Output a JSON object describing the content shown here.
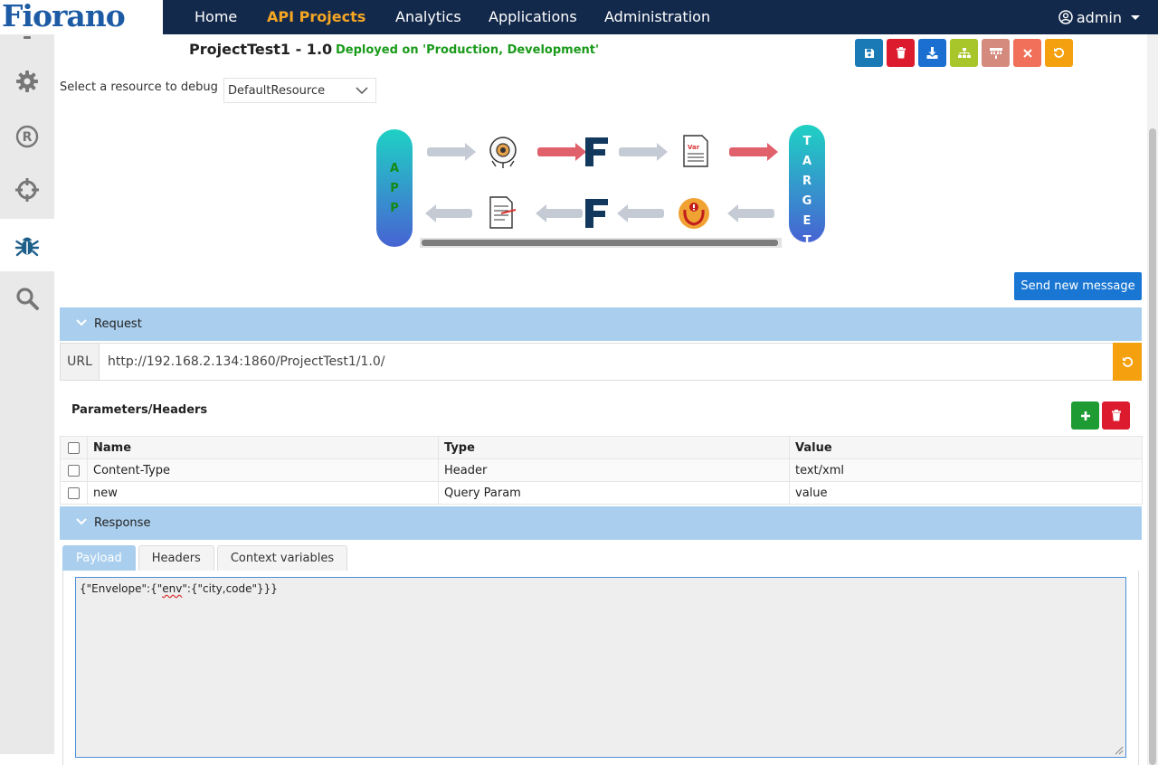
{
  "brand": {
    "logo_text": "Fiorano"
  },
  "nav": {
    "items": [
      {
        "label": "Home",
        "active": false
      },
      {
        "label": "API Projects",
        "active": true
      },
      {
        "label": "Analytics",
        "active": false
      },
      {
        "label": "Applications",
        "active": false
      },
      {
        "label": "Administration",
        "active": false
      }
    ],
    "user": "admin"
  },
  "sidebar": {
    "items": [
      {
        "icon": "gear-icon",
        "active": false
      },
      {
        "icon": "registered-icon",
        "active": false
      },
      {
        "icon": "crosshair-icon",
        "active": false
      },
      {
        "icon": "bug-icon",
        "active": true
      },
      {
        "icon": "search-icon",
        "active": false
      }
    ]
  },
  "project": {
    "title": "ProjectTest1 - 1.0",
    "deployed": "Deployed on 'Production, Development'"
  },
  "toolbar": {
    "buttons": [
      {
        "icon": "save-icon",
        "color": "#1a7ab5"
      },
      {
        "icon": "trash-icon",
        "color": "#dc1b2e"
      },
      {
        "icon": "download-icon",
        "color": "#1a6fd0"
      },
      {
        "icon": "sitemap-icon",
        "color": "#a8c52a"
      },
      {
        "icon": "network-icon",
        "color": "#d48a7d"
      },
      {
        "icon": "close-icon",
        "color": "#f0705a"
      },
      {
        "icon": "undo-icon",
        "color": "#f5a00f"
      }
    ]
  },
  "debug": {
    "resource_label": "Select a resource to debug",
    "resource_value": "DefaultResource"
  },
  "flow": {
    "app_letters": [
      "A",
      "P",
      "P"
    ],
    "target_letters": [
      "T",
      "A",
      "R",
      "G",
      "E",
      "T"
    ]
  },
  "send_button": "Send new message",
  "request": {
    "section_label": "Request",
    "url_label": "URL",
    "url_value": "http://192.168.2.134:1860/ProjectTest1/1.0/"
  },
  "params": {
    "title": "Parameters/Headers",
    "columns": [
      "Name",
      "Type",
      "Value"
    ],
    "rows": [
      {
        "name": "Content-Type",
        "type": "Header",
        "value": "text/xml"
      },
      {
        "name": "new",
        "type": "Query Param",
        "value": "value"
      }
    ]
  },
  "response": {
    "section_label": "Response",
    "tabs": [
      "Payload",
      "Headers",
      "Context variables"
    ],
    "payload_prefix": "{\"Envelope\":{\"",
    "payload_env": "env",
    "payload_suffix": "\":{\"city,code\"}}}"
  }
}
